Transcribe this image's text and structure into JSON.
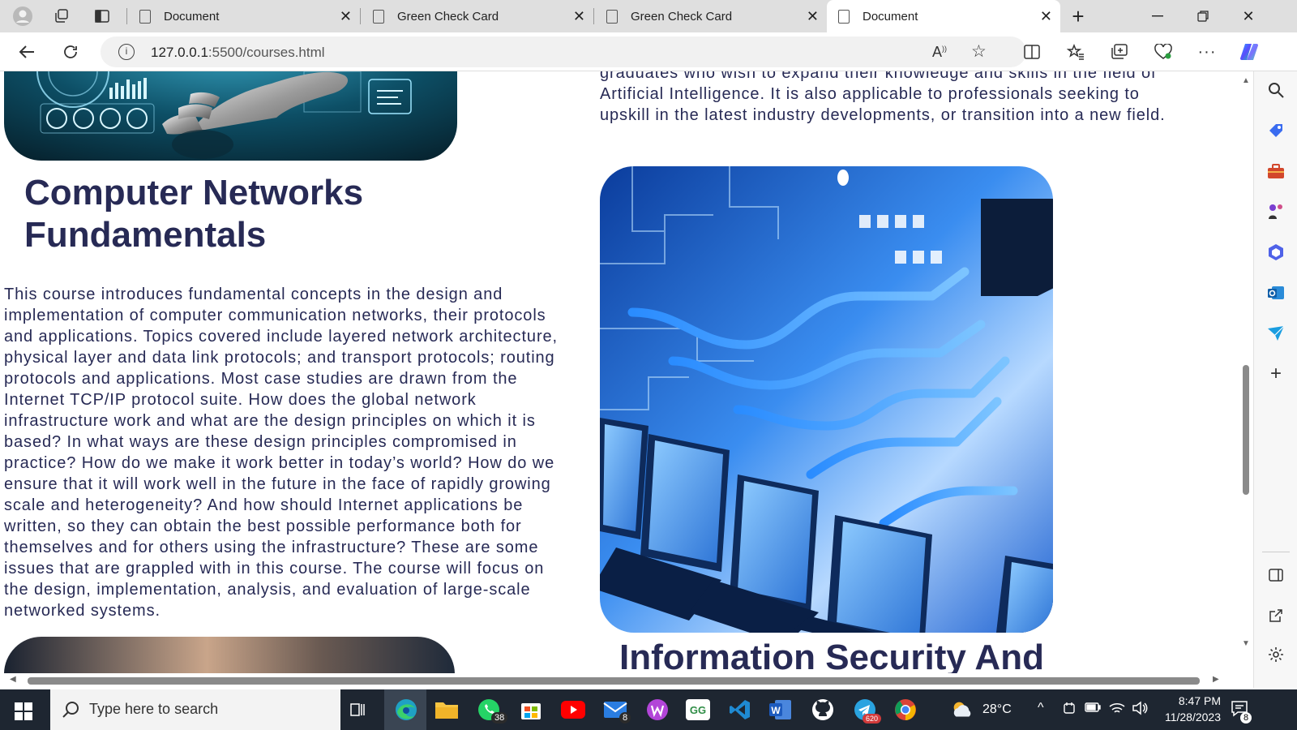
{
  "browser": {
    "tabs": [
      {
        "title": "Document",
        "active": false
      },
      {
        "title": "Green Check Card",
        "active": false
      },
      {
        "title": "Green Check Card",
        "active": false
      },
      {
        "title": "Document",
        "active": true
      }
    ],
    "url_host": "127.0.0.1",
    "url_path": ":5500/courses.html"
  },
  "page": {
    "intro_paragraph": "graduates who wish to expand their knowledge and skills in the field of Artificial Intelligence. It is also applicable to professionals seeking to upskill in the latest industry developments, or transition into a new field.",
    "course": {
      "title": "Computer Networks Fundamentals",
      "description": "This course introduces fundamental concepts in the design and implementation of computer communication networks, their protocols and applications. Topics covered include layered network architecture, physical layer and data link protocols; and transport protocols; routing protocols and applications. Most case studies are drawn from the Internet TCP/IP protocol suite. How does the global network infrastructure work and what are the design principles on which it is based? In what ways are these design principles compromised in practice? How do we make it work better in today’s world? How do we ensure that it will work well in the future in the face of rapidly growing scale and heterogeneity? And how should Internet applications be written, so they can obtain the best possible performance both for themselves and for others using the infrastructure? These are some issues that are grappled with in this course. The course will focus on the design, implementation, analysis, and evaluation of large-scale networked systems."
    },
    "next_course_title": "Information Security And"
  },
  "taskbar": {
    "search_placeholder": "Type here to search",
    "whatsapp_badge": "38",
    "mail_badge": "8",
    "telegram_badge": "620",
    "weather": "28°C",
    "time": "8:47 PM",
    "date": "11/28/2023",
    "notifications": "8"
  },
  "colors": {
    "heading": "#272a55",
    "taskbar": "#1e2631",
    "tab_strip": "#dfdfdf"
  }
}
